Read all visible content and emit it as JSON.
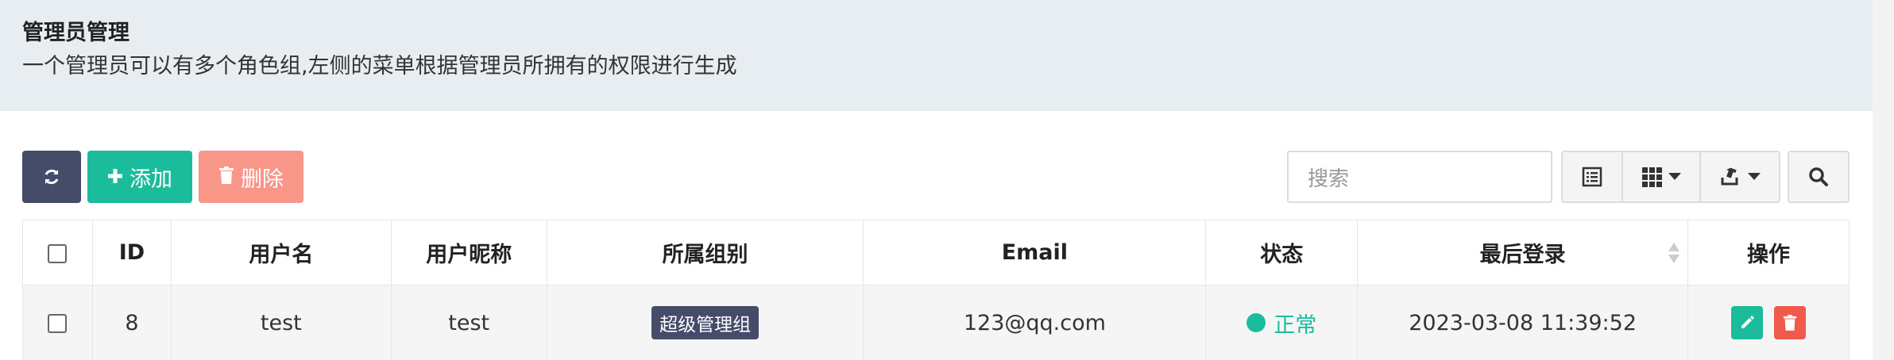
{
  "header": {
    "title": "管理员管理",
    "description": "一个管理员可以有多个角色组,左侧的菜单根据管理员所拥有的权限进行生成"
  },
  "toolbar": {
    "add_label": "添加",
    "delete_label": "删除",
    "search_placeholder": "搜索"
  },
  "table": {
    "columns": [
      "ID",
      "用户名",
      "用户昵称",
      "所属组别",
      "Email",
      "状态",
      "最后登录",
      "操作"
    ],
    "rows": [
      {
        "id": "8",
        "username": "test",
        "nickname": "test",
        "group": "超级管理组",
        "email": "123@qq.com",
        "status": "正常",
        "last_login": "2023-03-08 11:39:52"
      }
    ]
  },
  "colors": {
    "primary": "#444c69",
    "success": "#1bbc9b",
    "danger_light": "#f8968a",
    "danger": "#f05a4b"
  },
  "icons": [
    "refresh-icon",
    "plus-icon",
    "trash-icon",
    "list-view-icon",
    "grid-icon",
    "export-icon",
    "search-icon",
    "pencil-icon",
    "caret-down-icon"
  ]
}
